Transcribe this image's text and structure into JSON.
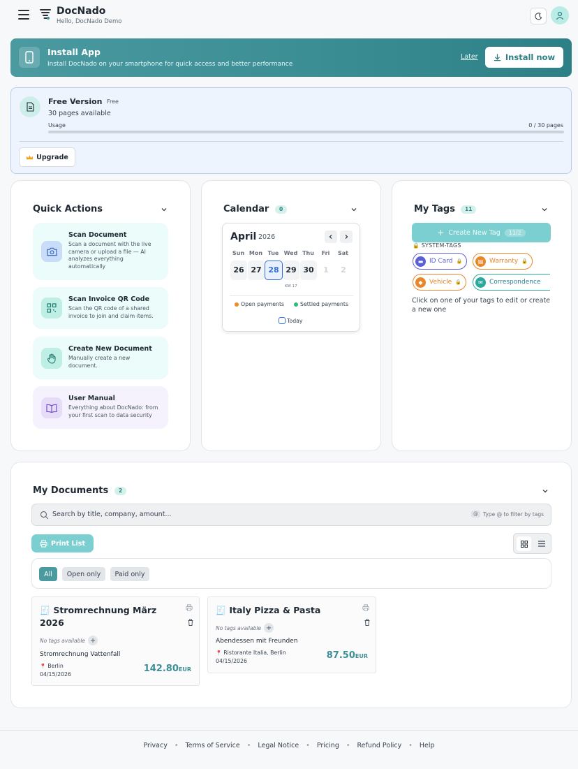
{
  "header": {
    "title": "DocNado",
    "greeting": "Hello, DocNado Demo"
  },
  "install_banner": {
    "title": "Install App",
    "description": "Install DocNado on your smartphone for quick access and better performance",
    "later_label": "Later",
    "install_label": "Install now"
  },
  "plan": {
    "title": "Free Version",
    "badge": "Free",
    "pages_available": "30 pages available",
    "usage_label": "Usage",
    "usage_value": "0 / 30 pages",
    "usage_fraction": 0,
    "upgrade_label": "Upgrade"
  },
  "quick_actions": {
    "title": "Quick Actions",
    "items": [
      {
        "title": "Scan Document",
        "description": "Scan a document with the live camera or upload a file — AI analyzes everything automatically",
        "icon": "camera-icon"
      },
      {
        "title": "Scan Invoice QR Code",
        "description": "Scan the QR code of a shared invoice to join and claim items.",
        "icon": "qr-code-icon"
      },
      {
        "title": "Create New Document",
        "description": "Manually create a new document.",
        "icon": "hand-icon"
      },
      {
        "title": "User Manual",
        "description": "Everything about DocNado: from your first scan to data security",
        "icon": "book-icon"
      }
    ]
  },
  "calendar": {
    "title": "Calendar",
    "count": "0",
    "month": "April",
    "year": "2026",
    "weekdays": [
      "Sun",
      "Mon",
      "Tue",
      "Wed",
      "Thu",
      "Fri",
      "Sat"
    ],
    "days": [
      "26",
      "27",
      "28",
      "29",
      "30",
      "1",
      "2"
    ],
    "selected_day": "28",
    "week_label": "KW 17",
    "legend_open": "Open payments",
    "legend_settled": "Settled payments",
    "today_label": "Today",
    "colors": {
      "open": "#f08a24",
      "settled": "#2fbf71",
      "selected": "#2f6fd6"
    }
  },
  "tags": {
    "title": "My Tags",
    "count": "11",
    "create_label": "Create New Tag",
    "limit": "11/2",
    "system_label": "SYSTEM-TAGS",
    "items": [
      {
        "label": "ID Card",
        "color": "#5b5fd6"
      },
      {
        "label": "Warranty",
        "color": "#e8862a"
      },
      {
        "label": "Vehicle",
        "color": "#e8862a"
      },
      {
        "label": "Correspondence",
        "color": "#2aa89a"
      }
    ],
    "hint": "Click on one of your tags to edit or create a new one"
  },
  "documents": {
    "title": "My Documents",
    "count": "2",
    "search_placeholder": "Search by title, company, amount...",
    "search_hint": "Type @ to filter by tags",
    "search_hint_key": "@",
    "print_label": "Print List",
    "filters": [
      "All",
      "Open only",
      "Paid only"
    ],
    "active_filter": "All",
    "no_tags": "No tags available",
    "items": [
      {
        "title": "Stromrechnung März 2026",
        "subtitle": "Stromrechnung Vattenfall",
        "location": "Berlin",
        "date": "04/15/2026",
        "amount": "142.80",
        "currency": "EUR"
      },
      {
        "title": "Italy Pizza & Pasta",
        "subtitle": "Abendessen mit Freunden",
        "location": "Ristorante Italia, Berlin",
        "date": "04/15/2026",
        "amount": "87.50",
        "currency": "EUR"
      }
    ]
  },
  "footer": {
    "links": [
      "Privacy",
      "Terms of Service",
      "Legal Notice",
      "Pricing",
      "Refund Policy",
      "Help"
    ]
  }
}
